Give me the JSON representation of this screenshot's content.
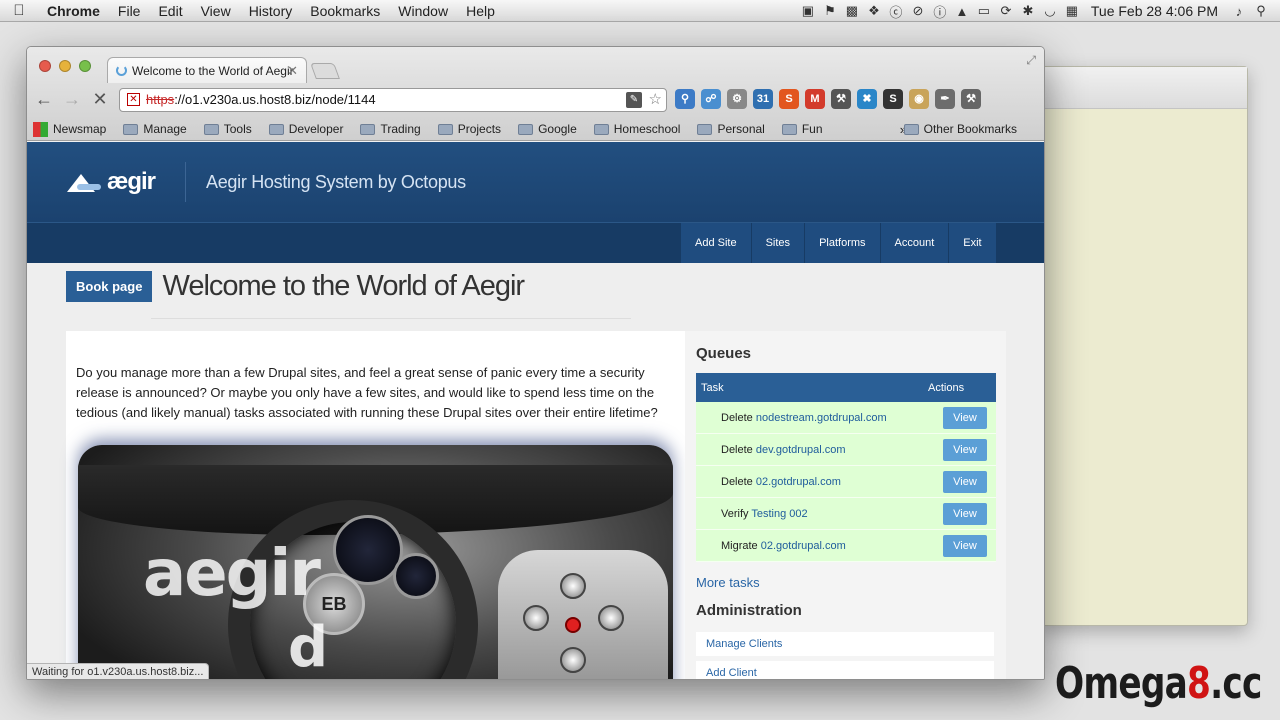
{
  "menubar": {
    "app": "Chrome",
    "items": [
      "File",
      "Edit",
      "View",
      "History",
      "Bookmarks",
      "Window",
      "Help"
    ],
    "clock": "Tue Feb 28  4:06 PM",
    "status_icons": [
      "terminal-icon",
      "flag-icon",
      "folder-icon",
      "dropbox-icon",
      "t-icon",
      "no-entry-icon",
      "info-icon",
      "lock-icon",
      "display-icon",
      "time-machine-icon",
      "bluetooth-icon",
      "wifi-icon",
      "calendar-icon",
      "volume-icon",
      "search-icon"
    ]
  },
  "browser": {
    "tab_title": "Welcome to the World of Aegir",
    "url_scheme": "https",
    "url_rest": "://o1.v230a.us.host8.biz/node/1144",
    "bookmarks": [
      "Newsmap",
      "Manage",
      "Tools",
      "Developer",
      "Trading",
      "Projects",
      "Google",
      "Homeschool",
      "Personal",
      "Fun"
    ],
    "bookmark_more": "»",
    "other_bookmarks": "Other Bookmarks",
    "status_text": "Waiting for o1.v230a.us.host8.biz..."
  },
  "site": {
    "logo_text": "ægir",
    "name": "Aegir Hosting System by Octopus",
    "nav": [
      "Add Site",
      "Sites",
      "Platforms",
      "Account",
      "Exit"
    ]
  },
  "page": {
    "badge": "Book page",
    "title": "Welcome to the World of Aegir",
    "intro": "Do you manage more than a few Drupal sites, and feel a great sense of panic every time a security release is announced? Or maybe you only have a few sites, and would like to spend less time on the tedious (and likely manual) tasks associated with running these Drupal sites over their entire lifetime?",
    "hero_word": "aegir",
    "hero_letter": "d",
    "hero_hub": "EB"
  },
  "queues": {
    "heading": "Queues",
    "col_task": "Task",
    "col_actions": "Actions",
    "rows": [
      {
        "action": "Delete",
        "target": "nodestream.gotdrupal.com",
        "button": "View"
      },
      {
        "action": "Delete",
        "target": "dev.gotdrupal.com",
        "button": "View"
      },
      {
        "action": "Delete",
        "target": "02.gotdrupal.com",
        "button": "View"
      },
      {
        "action": "Verify",
        "target": "Testing 002",
        "button": "View"
      },
      {
        "action": "Migrate",
        "target": "02.gotdrupal.com",
        "button": "View"
      }
    ],
    "more": "More tasks"
  },
  "admin": {
    "heading": "Administration",
    "links": [
      "Manage Clients",
      "Add Client"
    ]
  },
  "watermark": {
    "prefix": "Omega",
    "eight": "8",
    "suffix": ".cc"
  },
  "colors": {
    "header": "#1d4776",
    "navbar": "#173b64",
    "badge": "#2a5f96",
    "queue_row": "#dfffd4",
    "view_button": "#5b9fd6"
  }
}
